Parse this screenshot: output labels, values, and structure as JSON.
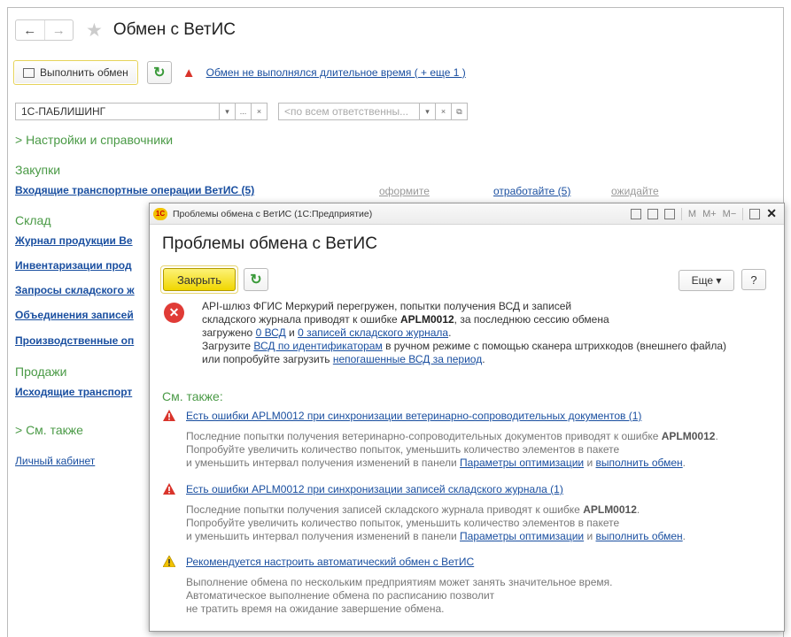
{
  "window": {
    "title": "Обмен с ВетИС",
    "nav_back": "←",
    "nav_forward": "→"
  },
  "toolbar": {
    "exchange_label": "Выполнить обмен",
    "refresh_symbol": "↻",
    "warning_link": "Обмен не выполнялся длительное время ( + еще 1 )"
  },
  "filters": {
    "organization_value": "1С-ПАБЛИШИНГ",
    "responsible_placeholder": "<по всем ответственны...",
    "dropdown_symbol": "▾",
    "ellipsis_symbol": "...",
    "clear_symbol": "×",
    "open_symbol": "⧉"
  },
  "sections": {
    "settings": "> Настройки и справочники",
    "purchases": "Закупки",
    "purchases_link": "Входящие транспортные операции ВетИС (5)",
    "purchases_format": "оформите",
    "purchases_process": "отработайте (5)",
    "purchases_wait": "ожидайте",
    "warehouse": "Склад",
    "warehouse_links": [
      "Журнал продукции Ве",
      "Инвентаризации прод",
      "Запросы складского ж",
      "Объединения записей",
      "Производственные оп"
    ],
    "sales": "Продажи",
    "sales_link": "Исходящие транспорт",
    "see_also": "> См. также",
    "cabinet": "Личный кабинет"
  },
  "dialog": {
    "window_title": "Проблемы обмена с ВетИС  (1С:Предприятие)",
    "logo": "1С",
    "title_tools": {
      "m": "M",
      "mplus": "M+",
      "mminus": "M−",
      "close": "✕"
    },
    "heading": "Проблемы обмена с ВетИС",
    "close_button": "Закрыть",
    "more_button": "Еще ▾",
    "help_button": "?",
    "error_icon": "✕",
    "message": {
      "line1": "API-шлюз ФГИС Меркурий перегружен, попытки получения ВСД и записей",
      "line2_a": "складского журнала приводят к ошибке ",
      "line2_code": "APLM0012",
      "line2_b": ", за последнюю сессию обмена",
      "line3_a": "загружено ",
      "line3_link1": "0 ВСД",
      "line3_b": " и ",
      "line3_link2": "0 записей складского журнала",
      "line3_c": ".",
      "line4_a": "Загрузите ",
      "line4_link": "ВСД по идентификаторам",
      "line4_b": " в ручном режиме с помощью сканера штрихкодов (внешнего файла)",
      "line5_a": "или попробуйте загрузить ",
      "line5_link": "непогашенные ВСД за период",
      "line5_b": "."
    },
    "see_also_title": "См. также:",
    "items": [
      {
        "link": "Есть ошибки APLM0012 при синхронизации ветеринарно-сопроводительных документов (1)",
        "d1_a": "Последние попытки получения ветеринарно-сопроводительных документов приводят к ошибке ",
        "d1_code": "APLM0012",
        "d1_b": ".",
        "d2": "Попробуйте увеличить количество попыток, уменьшить количество элементов в пакете",
        "d3_a": "и уменьшить интервал получения изменений в панели ",
        "d3_link1": "Параметры оптимизации",
        "d3_b": " и ",
        "d3_link2": "выполнить обмен",
        "d3_c": "."
      },
      {
        "link": "Есть ошибки APLM0012 при синхронизации записей складского журнала (1)",
        "d1_a": "Последние попытки получения записей складского журнала приводят к ошибке ",
        "d1_code": "APLM0012",
        "d1_b": ".",
        "d2": "Попробуйте увеличить количество попыток, уменьшить количество элементов в пакете",
        "d3_a": "и уменьшить интервал получения изменений в панели ",
        "d3_link1": "Параметры оптимизации",
        "d3_b": " и ",
        "d3_link2": "выполнить обмен",
        "d3_c": "."
      },
      {
        "link": "Рекомендуется настроить автоматический обмен с ВетИС",
        "d1": "Выполнение обмена по нескольким предприятиям может занять значительное время.",
        "d2": "Автоматическое выполнение обмена по расписанию позволит",
        "d3": "не тратить время на ожидание завершение обмена."
      }
    ]
  },
  "colors": {
    "accent_green": "#4a9a46",
    "link_blue": "#1a4fa0",
    "error_red": "#e03b36",
    "warning_yellow": "#f2c200"
  }
}
